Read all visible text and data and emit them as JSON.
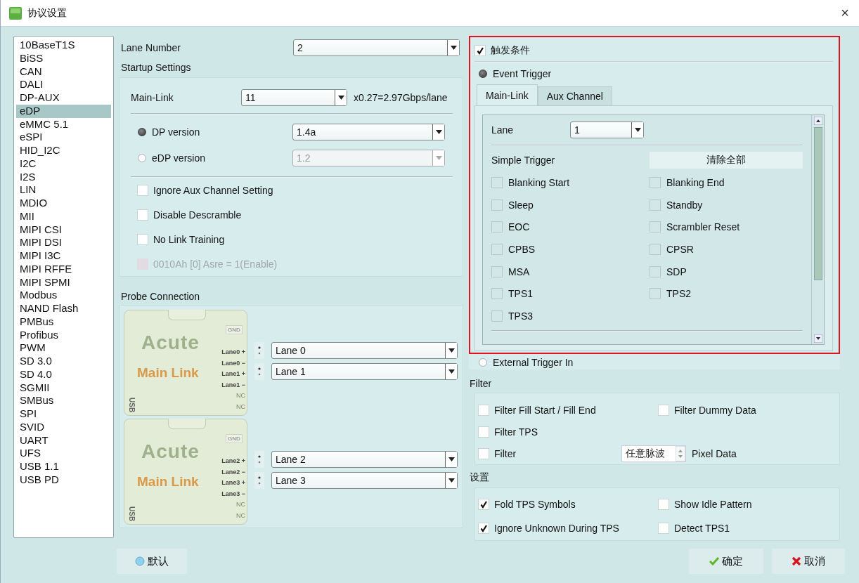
{
  "window": {
    "title": "协议设置",
    "close": "×"
  },
  "protocols": [
    {
      "label": "10BaseT1S",
      "selected": false
    },
    {
      "label": "BiSS",
      "selected": false
    },
    {
      "label": "CAN",
      "selected": false
    },
    {
      "label": "DALI",
      "selected": false
    },
    {
      "label": "DP-AUX",
      "selected": false
    },
    {
      "label": "eDP",
      "selected": true
    },
    {
      "label": "eMMC 5.1",
      "selected": false
    },
    {
      "label": "eSPI",
      "selected": false
    },
    {
      "label": "HID_I2C",
      "selected": false
    },
    {
      "label": "I2C",
      "selected": false
    },
    {
      "label": "I2S",
      "selected": false
    },
    {
      "label": "LIN",
      "selected": false
    },
    {
      "label": "MDIO",
      "selected": false
    },
    {
      "label": "MII",
      "selected": false
    },
    {
      "label": "MIPI CSI",
      "selected": false
    },
    {
      "label": "MIPI DSI",
      "selected": false
    },
    {
      "label": "MIPI I3C",
      "selected": false
    },
    {
      "label": "MIPI RFFE",
      "selected": false
    },
    {
      "label": "MIPI SPMI",
      "selected": false
    },
    {
      "label": "Modbus",
      "selected": false
    },
    {
      "label": "NAND Flash",
      "selected": false
    },
    {
      "label": "PMBus",
      "selected": false
    },
    {
      "label": "Profibus",
      "selected": false
    },
    {
      "label": "PWM",
      "selected": false
    },
    {
      "label": "SD 3.0",
      "selected": false
    },
    {
      "label": "SD 4.0",
      "selected": false
    },
    {
      "label": "SGMII",
      "selected": false
    },
    {
      "label": "SMBus",
      "selected": false
    },
    {
      "label": "SPI",
      "selected": false
    },
    {
      "label": "SVID",
      "selected": false
    },
    {
      "label": "UART",
      "selected": false
    },
    {
      "label": "UFS",
      "selected": false
    },
    {
      "label": "USB 1.1",
      "selected": false
    },
    {
      "label": "USB PD",
      "selected": false
    }
  ],
  "lane_number": {
    "label": "Lane Number",
    "value": "2"
  },
  "startup": {
    "title": "Startup Settings",
    "main_link": {
      "label": "Main-Link",
      "value": "11",
      "note": "x0.27=2.97Gbps/lane"
    },
    "versions": [
      {
        "label": "DP version",
        "value": "1.4a",
        "selected": true,
        "disabled": false
      },
      {
        "label": "eDP version",
        "value": "1.2",
        "selected": false,
        "disabled": true
      }
    ],
    "options": [
      {
        "label": "Ignore Aux Channel Setting",
        "checked": false,
        "disabled": false
      },
      {
        "label": "Disable Descramble",
        "checked": false,
        "disabled": false
      },
      {
        "label": "No Link Training",
        "checked": false,
        "disabled": false
      },
      {
        "label": "0010Ah [0]  Asre = 1(Enable)",
        "checked": false,
        "disabled": true
      }
    ]
  },
  "probe": {
    "title": "Probe Connection",
    "cards": [
      {
        "brand": "Acute",
        "name": "Main Link",
        "gnd": "GND",
        "pins": [
          "Lane0 +",
          "Lane0 −",
          "Lane1 +",
          "Lane1 −",
          "NC",
          "NC"
        ],
        "usb": "USB",
        "lanes": [
          "Lane 0",
          "Lane 1"
        ]
      },
      {
        "brand": "Acute",
        "name": "Main Link",
        "gnd": "GND",
        "pins": [
          "Lane2 +",
          "Lane2 −",
          "Lane3 +",
          "Lane3 −",
          "NC",
          "NC"
        ],
        "usb": "USB",
        "lanes": [
          "Lane 2",
          "Lane 3"
        ]
      }
    ]
  },
  "trigger": {
    "label": "触发条件",
    "checked": true,
    "modes": [
      {
        "label": "Event Trigger",
        "selected": true
      },
      {
        "label": "External Trigger In",
        "selected": false
      }
    ],
    "tabs": [
      {
        "label": "Main-Link",
        "selected": true
      },
      {
        "label": "Aux Channel",
        "selected": false
      }
    ],
    "lane": {
      "label": "Lane",
      "value": "1"
    },
    "simple_title": "Simple Trigger",
    "clear_button": "清除全部",
    "items": [
      {
        "label": "Blanking Start",
        "checked": false
      },
      {
        "label": "Blanking End",
        "checked": false
      },
      {
        "label": "Sleep",
        "checked": false
      },
      {
        "label": "Standby",
        "checked": false
      },
      {
        "label": "EOC",
        "checked": false
      },
      {
        "label": "Scrambler Reset",
        "checked": false
      },
      {
        "label": "CPBS",
        "checked": false
      },
      {
        "label": "CPSR",
        "checked": false
      },
      {
        "label": "MSA",
        "checked": false
      },
      {
        "label": "SDP",
        "checked": false
      },
      {
        "label": "TPS1",
        "checked": false
      },
      {
        "label": "TPS2",
        "checked": false
      },
      {
        "label": "TPS3",
        "checked": false
      }
    ]
  },
  "filter": {
    "title": "Filter",
    "rows": [
      {
        "cells": [
          {
            "kind": "check",
            "label": "Filter Fill Start / Fill End",
            "checked": false
          },
          {
            "kind": "check",
            "label": "Filter Dummy Data",
            "checked": false
          }
        ]
      },
      {
        "cells": [
          {
            "kind": "check",
            "label": "Filter TPS",
            "checked": false
          }
        ]
      },
      {
        "cells": [
          {
            "kind": "check",
            "label": "Filter",
            "checked": false
          },
          {
            "kind": "spin",
            "value": "任意脉波",
            "label": "Pixel Data"
          }
        ]
      }
    ]
  },
  "settings": {
    "title": "设置",
    "items": [
      {
        "label": "Fold TPS Symbols",
        "checked": true
      },
      {
        "label": "Show Idle Pattern",
        "checked": false
      },
      {
        "label": "Ignore Unknown During TPS",
        "checked": true
      },
      {
        "label": "Detect TPS1",
        "checked": false
      }
    ]
  },
  "buttons": [
    {
      "kind": "default",
      "label": "默认"
    },
    {
      "kind": "ok",
      "label": "确定"
    },
    {
      "kind": "cancel",
      "label": "取消"
    }
  ]
}
